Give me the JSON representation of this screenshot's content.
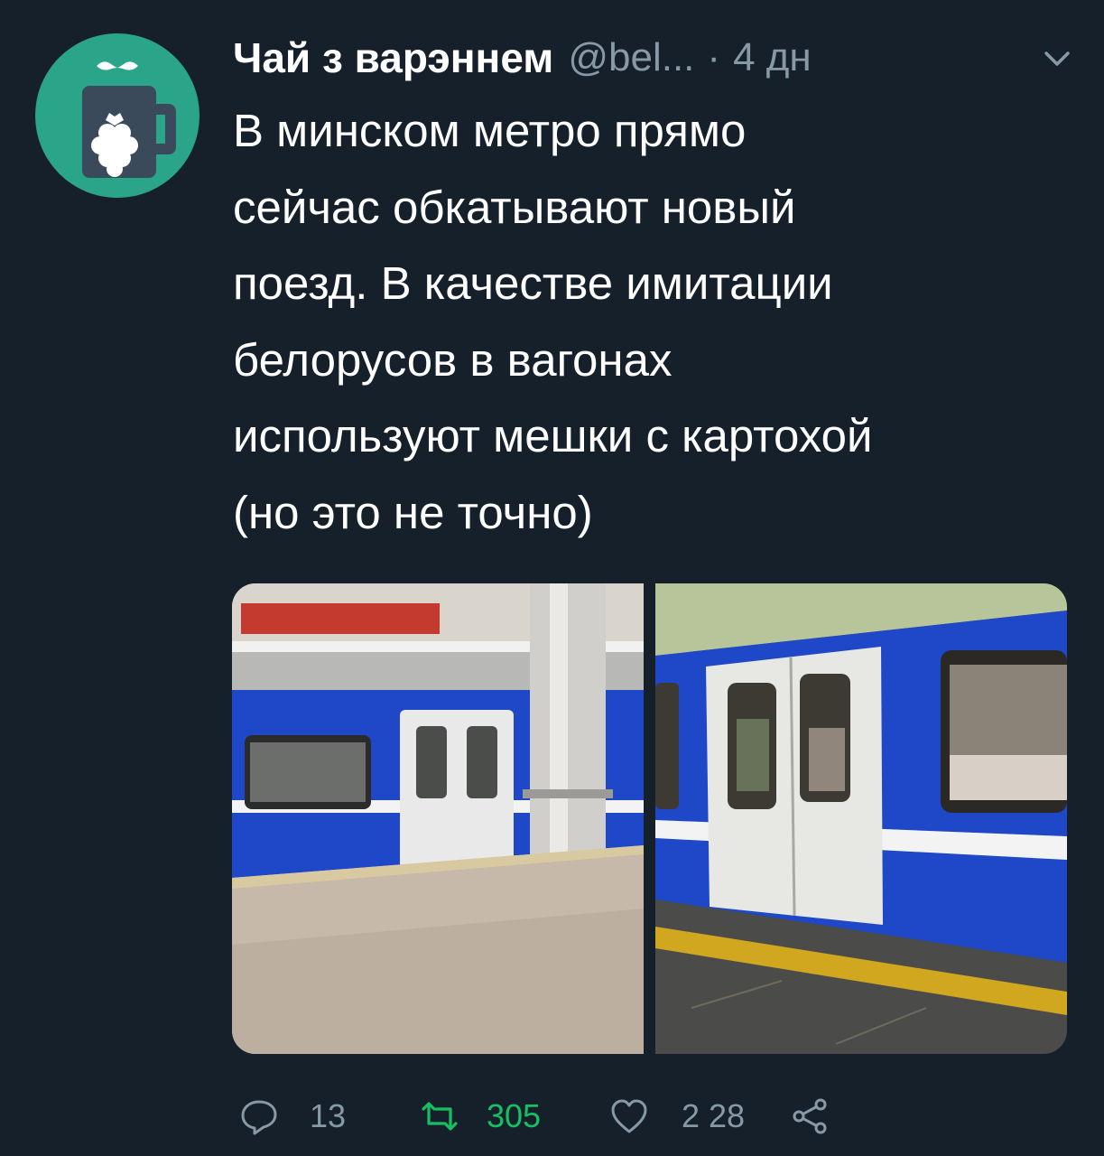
{
  "account": {
    "name": "Чай з варэннем",
    "handle": "@bel...",
    "separator": "·",
    "time": "4 дн"
  },
  "tweet": {
    "text": "В минском метро прямо\nсейчас обкатывают новый\nпоезд. В качестве имитации\nбелорусов в вагонах\nиспользуют мешки с картохой\n(но это не точно)"
  },
  "actions": {
    "replies": "13",
    "retweets": "305",
    "likes": "2 28"
  },
  "icons": {
    "avatar": "tea-mug-raspberry-icon",
    "menu": "chevron-down-icon",
    "reply": "reply-icon",
    "retweet": "retweet-icon",
    "like": "heart-icon",
    "share": "share-icon"
  },
  "colors": {
    "background": "#15202b",
    "secondary_text": "#8899a6",
    "avatar_bg": "#2aa58a",
    "retweet_green": "#17bf63",
    "train_blue": "#1f48c8"
  }
}
